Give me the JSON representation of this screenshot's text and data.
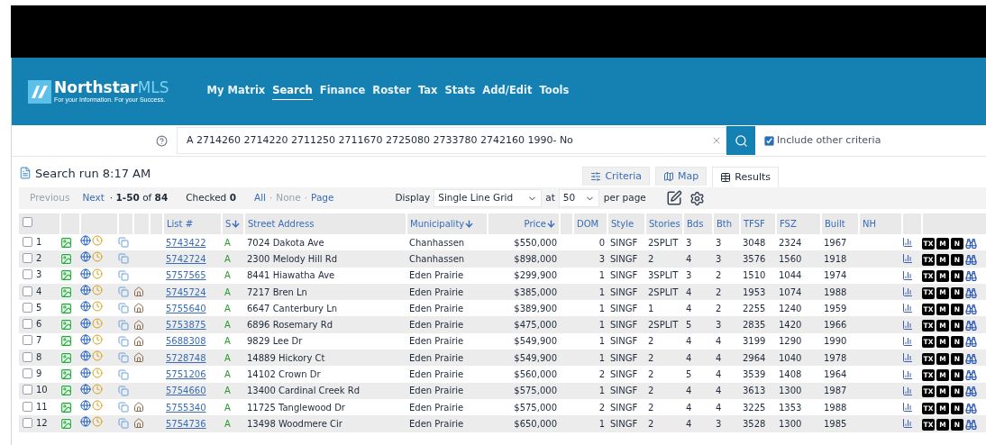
{
  "logo": {
    "name": "Northstar",
    "suffix": "MLS",
    "tagline": "For your Information. For your Success."
  },
  "nav": [
    {
      "label": "My Matrix",
      "selected": false
    },
    {
      "label": "Search",
      "selected": true
    },
    {
      "label": "Finance",
      "selected": false
    },
    {
      "label": "Roster",
      "selected": false
    },
    {
      "label": "Tax",
      "selected": false
    },
    {
      "label": "Stats",
      "selected": false
    },
    {
      "label": "Add/Edit",
      "selected": false
    },
    {
      "label": "Tools",
      "selected": false
    }
  ],
  "search": {
    "value": "A 2714260 2714220 2711250 2711670 2725080 2733780 2742160 1990- No",
    "include_other": {
      "label": "Include other criteria",
      "checked": true
    }
  },
  "results_title": "Search run 8:17 AM",
  "view_tabs": [
    {
      "label": "Criteria",
      "kind": "criteria",
      "selected": false
    },
    {
      "label": "Map",
      "kind": "map",
      "selected": false
    },
    {
      "label": "Results",
      "kind": "results",
      "selected": true
    }
  ],
  "pager": {
    "previous": {
      "label": "Previous",
      "disabled": true
    },
    "next": {
      "label": "Next",
      "disabled": false
    },
    "range": "· **1-50** of **84**",
    "checked_label": "Checked",
    "checked_count": "0",
    "select_links": [
      {
        "label": "All",
        "disabled": false
      },
      {
        "separator": "·",
        "label": "None",
        "disabled": true
      },
      {
        "separator": "·",
        "label": "Page",
        "disabled": false
      }
    ]
  },
  "display": {
    "label": "Display",
    "value": "Single Line Grid",
    "at_label": "at",
    "per_page": "50",
    "per_page_label": "per page"
  },
  "table": {
    "columns": [
      "List #",
      "S",
      "Street Address",
      "Municipality",
      "Price",
      "DOM",
      "Style",
      "Stories",
      "Bds",
      "Bth",
      "TFSF",
      "FSZ",
      "Built",
      "NH"
    ],
    "rows": [
      {
        "num": "1",
        "checked": false,
        "extra_icon": false,
        "badges": [
          "TX",
          "M",
          "N"
        ],
        "cells": [
          "5743422",
          "A",
          "7024 Dakota Ave",
          "Chanhassen",
          "$550,000",
          "0",
          "SINGF",
          "2SPLIT",
          "3",
          "3",
          "3048",
          "2324",
          "1967"
        ]
      },
      {
        "num": "2",
        "checked": false,
        "extra_icon": false,
        "badges": [
          "TX",
          "M",
          "N"
        ],
        "cells": [
          "5742724",
          "A",
          "2300 Melody Hill Rd",
          "Chanhassen",
          "$898,000",
          "3",
          "SINGF",
          "2",
          "4",
          "3",
          "3576",
          "1560",
          "1918"
        ]
      },
      {
        "num": "3",
        "checked": false,
        "extra_icon": false,
        "badges": [
          "TX",
          "M",
          "N"
        ],
        "cells": [
          "5757565",
          "A",
          "8441 Hiawatha Ave",
          "Eden Prairie",
          "$299,900",
          "1",
          "SINGF",
          "3SPLIT",
          "3",
          "2",
          "1510",
          "1044",
          "1974"
        ]
      },
      {
        "num": "4",
        "checked": false,
        "extra_icon": true,
        "badges": [
          "TX",
          "M",
          "N"
        ],
        "cells": [
          "5745724",
          "A",
          "7217 Bren Ln",
          "Eden Prairie",
          "$385,000",
          "1",
          "SINGF",
          "2SPLIT",
          "4",
          "2",
          "1953",
          "1074",
          "1988"
        ]
      },
      {
        "num": "5",
        "checked": false,
        "extra_icon": true,
        "badges": [
          "TX",
          "M",
          "N"
        ],
        "cells": [
          "5755640",
          "A",
          "6647 Canterbury Ln",
          "Eden Prairie",
          "$389,900",
          "1",
          "SINGF",
          "1",
          "4",
          "2",
          "2255",
          "1240",
          "1959"
        ]
      },
      {
        "num": "6",
        "checked": false,
        "extra_icon": true,
        "badges": [
          "TX",
          "M",
          "N"
        ],
        "cells": [
          "5753875",
          "A",
          "6896 Rosemary Rd",
          "Eden Prairie",
          "$475,000",
          "1",
          "SINGF",
          "2SPLIT",
          "5",
          "3",
          "2835",
          "1420",
          "1966"
        ]
      },
      {
        "num": "7",
        "checked": false,
        "extra_icon": true,
        "badges": [
          "TX",
          "M",
          "N"
        ],
        "cells": [
          "5688308",
          "A",
          "9829 Lee Dr",
          "Eden Prairie",
          "$549,900",
          "1",
          "SINGF",
          "2",
          "4",
          "4",
          "3199",
          "1290",
          "1990"
        ]
      },
      {
        "num": "8",
        "checked": false,
        "extra_icon": true,
        "badges": [
          "TX",
          "M",
          "N"
        ],
        "cells": [
          "5728748",
          "A",
          "14889 Hickory Ct",
          "Eden Prairie",
          "$549,900",
          "1",
          "SINGF",
          "2",
          "4",
          "4",
          "2964",
          "1040",
          "1978"
        ]
      },
      {
        "num": "9",
        "checked": false,
        "extra_icon": false,
        "badges": [
          "TX",
          "M",
          "N"
        ],
        "cells": [
          "5751206",
          "A",
          "14102 Crown Dr",
          "Eden Prairie",
          "$560,000",
          "2",
          "SINGF",
          "2",
          "5",
          "4",
          "3539",
          "1408",
          "1964"
        ]
      },
      {
        "num": "10",
        "checked": false,
        "extra_icon": false,
        "badges": [
          "TX",
          "M",
          "N"
        ],
        "cells": [
          "5754660",
          "A",
          "13400 Cardinal Creek Rd",
          "Eden Prairie",
          "$575,000",
          "1",
          "SINGF",
          "2",
          "4",
          "4",
          "3613",
          "1300",
          "1987"
        ]
      },
      {
        "num": "11",
        "checked": false,
        "extra_icon": true,
        "badges": [
          "TX",
          "M",
          "N"
        ],
        "cells": [
          "5755340",
          "A",
          "11725 Tanglewood Dr",
          "Eden Prairie",
          "$575,000",
          "2",
          "SINGF",
          "2",
          "4",
          "4",
          "3225",
          "1353",
          "1988"
        ]
      },
      {
        "num": "12",
        "checked": false,
        "extra_icon": true,
        "badges": [
          "TX",
          "M",
          "N"
        ],
        "cells": [
          "5754736",
          "A",
          "13498 Woodmere Cir",
          "Eden Prairie",
          "$650,000",
          "1",
          "SINGF",
          "2",
          "4",
          "3",
          "3528",
          "1300",
          "1985"
        ]
      }
    ],
    "select_all_checked": false
  }
}
